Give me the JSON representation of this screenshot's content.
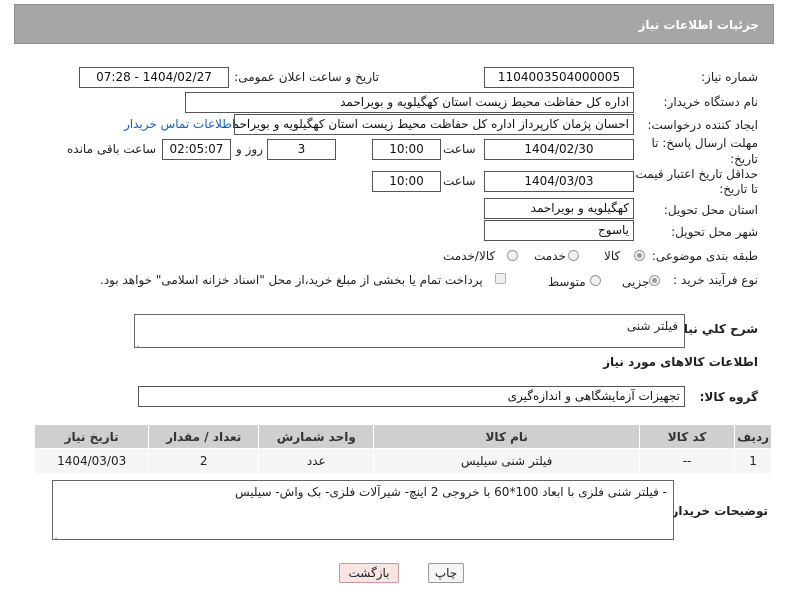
{
  "header": {
    "title": "جزئیات اطلاعات نیاز"
  },
  "labels": {
    "need_number": "شماره نیاز:",
    "announce_datetime": "تاریخ و ساعت اعلان عمومی:",
    "buyer_org": "نام دستگاه خریدار:",
    "requester": "ایجاد کننده درخواست:",
    "reply_deadline_1": "مهلت ارسال پاسخ: تا",
    "reply_deadline_2": "تاریخ:",
    "price_deadline_1": "حداقل تاریخ اعتبار قیمت:",
    "price_deadline_2": "تا تاریخ:",
    "time": "ساعت",
    "day_and": "روز و",
    "remaining": "ساعت باقی مانده",
    "delivery_province": "استان محل تحویل:",
    "delivery_city": "شهر محل تحویل:",
    "category": "طبقه بندی موضوعی:",
    "purchase_type": "نوع فرآیند خرید :",
    "general_desc": "شرح کلي نیاز:",
    "goods_info": "اطلاعات کالاهای مورد نیاز",
    "goods_group": "گروه کالا:",
    "buyer_notes": "توضیحات خریدار:"
  },
  "fields": {
    "need_number": "1104003504000005",
    "announce_datetime": "1404/02/27 - 07:28",
    "buyer_org": "اداره کل حفاظت محیط زیست استان کهگیلویه و بویراحمد",
    "requester": "احسان پژمان کارپرداز اداره کل حفاظت محیط زیست استان کهگیلویه و بویراحمد",
    "contact_link": "اطلاعات تماس خریدار",
    "reply_date": "1404/02/30",
    "reply_time": "10:00",
    "reply_days": "3",
    "reply_remaining": "02:05:07",
    "price_date": "1404/03/03",
    "price_time": "10:00",
    "delivery_province": "کهگیلویه و بویراحمد",
    "delivery_city": "یاسوج",
    "general_desc": "فیلتر شنی",
    "goods_group": "تجهیزات آزمایشگاهی و اندازه‌گیری",
    "buyer_notes": "- فیلتر شنی فلزی با ابعاد 100*60 با خروجی 2 اینچ- شیرآلات فلزی- بک واش- سیلیس"
  },
  "category_options": {
    "goods": "کالا",
    "service": "خدمت",
    "goods_service": "کالا/خدمت",
    "selected": "کالا"
  },
  "purchase_options": {
    "partial": "جزیی",
    "medium": "متوسط",
    "selected": "جزیی",
    "treasury_note": "پرداخت تمام یا بخشی از مبلغ خرید،از محل \"اسناد خزانه اسلامی\" خواهد بود."
  },
  "table": {
    "headers": [
      "ردیف",
      "کد کالا",
      "نام کالا",
      "واحد شمارش",
      "تعداد / مقدار",
      "تاریخ نیاز"
    ],
    "rows": [
      [
        "1",
        "--",
        "فیلتر شنی سیلیس",
        "عدد",
        "2",
        "1404/03/03"
      ]
    ]
  },
  "buttons": {
    "print": "چاپ",
    "back": "بازگشت"
  },
  "colors": {
    "header_bg": "#a6a6a6",
    "table_header_bg": "#cfcfcf",
    "back_button_bg": "#fbe4e4",
    "link": "#1a5fb4"
  }
}
